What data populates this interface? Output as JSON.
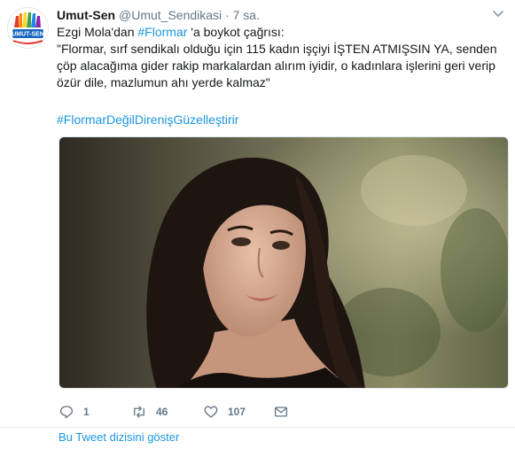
{
  "tweet": {
    "display_name": "Umut-Sen",
    "handle": "@Umut_Sendikasi",
    "separator": "·",
    "time": "7 sa.",
    "avatar_label": "UMUT-SEN",
    "line1_prefix": "Ezgi Mola'dan ",
    "line1_hashtag": "#Flormar",
    "line1_suffix": " 'a boykot çağrısı:",
    "quote": "\"Flormar, sırf sendikalı olduğu için 115 kadın işçiyi İŞTEN ATMIŞSIN YA, senden çöp alacağıma gider rakip markalardan alırım iyidir, o kadınlara işlerini geri verip özür dile, mazlumun ahı yerde kalmaz\"",
    "hashtag": "#FlormarDeğilDirenişGüzelleştirir",
    "actions": {
      "reply_count": "1",
      "retweet_count": "46",
      "like_count": "107"
    },
    "thread_link": "Bu Tweet dizisini göster"
  },
  "colors": {
    "link": "#1b95e0",
    "meta": "#657786",
    "text": "#14171a"
  },
  "icons": [
    "umut-sen-logo",
    "chevron-down-icon",
    "reply-icon",
    "retweet-icon",
    "like-icon",
    "message-icon"
  ]
}
